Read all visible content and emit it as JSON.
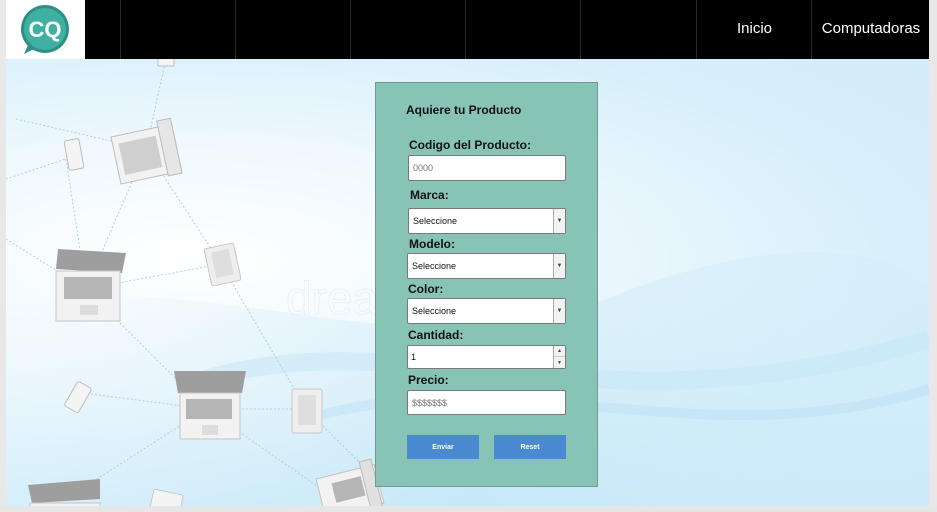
{
  "header": {
    "logo_text": "CQ",
    "nav": [
      {
        "label": "Inicio"
      },
      {
        "label": "Computadoras"
      }
    ]
  },
  "background": {
    "watermark": "dreamstime"
  },
  "form": {
    "title": "Aquiere tu Producto",
    "codigo": {
      "label": "Codigo del Producto:",
      "placeholder": "0000"
    },
    "marca": {
      "label": "Marca:",
      "selected": "Seleccione"
    },
    "modelo": {
      "label": "Modelo:",
      "selected": "Seleccione"
    },
    "color": {
      "label": "Color:",
      "selected": "Seleccione"
    },
    "cantidad": {
      "label": "Cantidad:",
      "value": "1"
    },
    "precio": {
      "label": "Precio:",
      "placeholder": "$$$$$$$"
    },
    "buttons": {
      "submit": "Enviar",
      "reset": "Reset"
    }
  },
  "colors": {
    "header_bg": "#000000",
    "panel_bg": "#88c4b6",
    "button_bg": "#4a8ad0",
    "logo_teal": "#3aa89a"
  }
}
